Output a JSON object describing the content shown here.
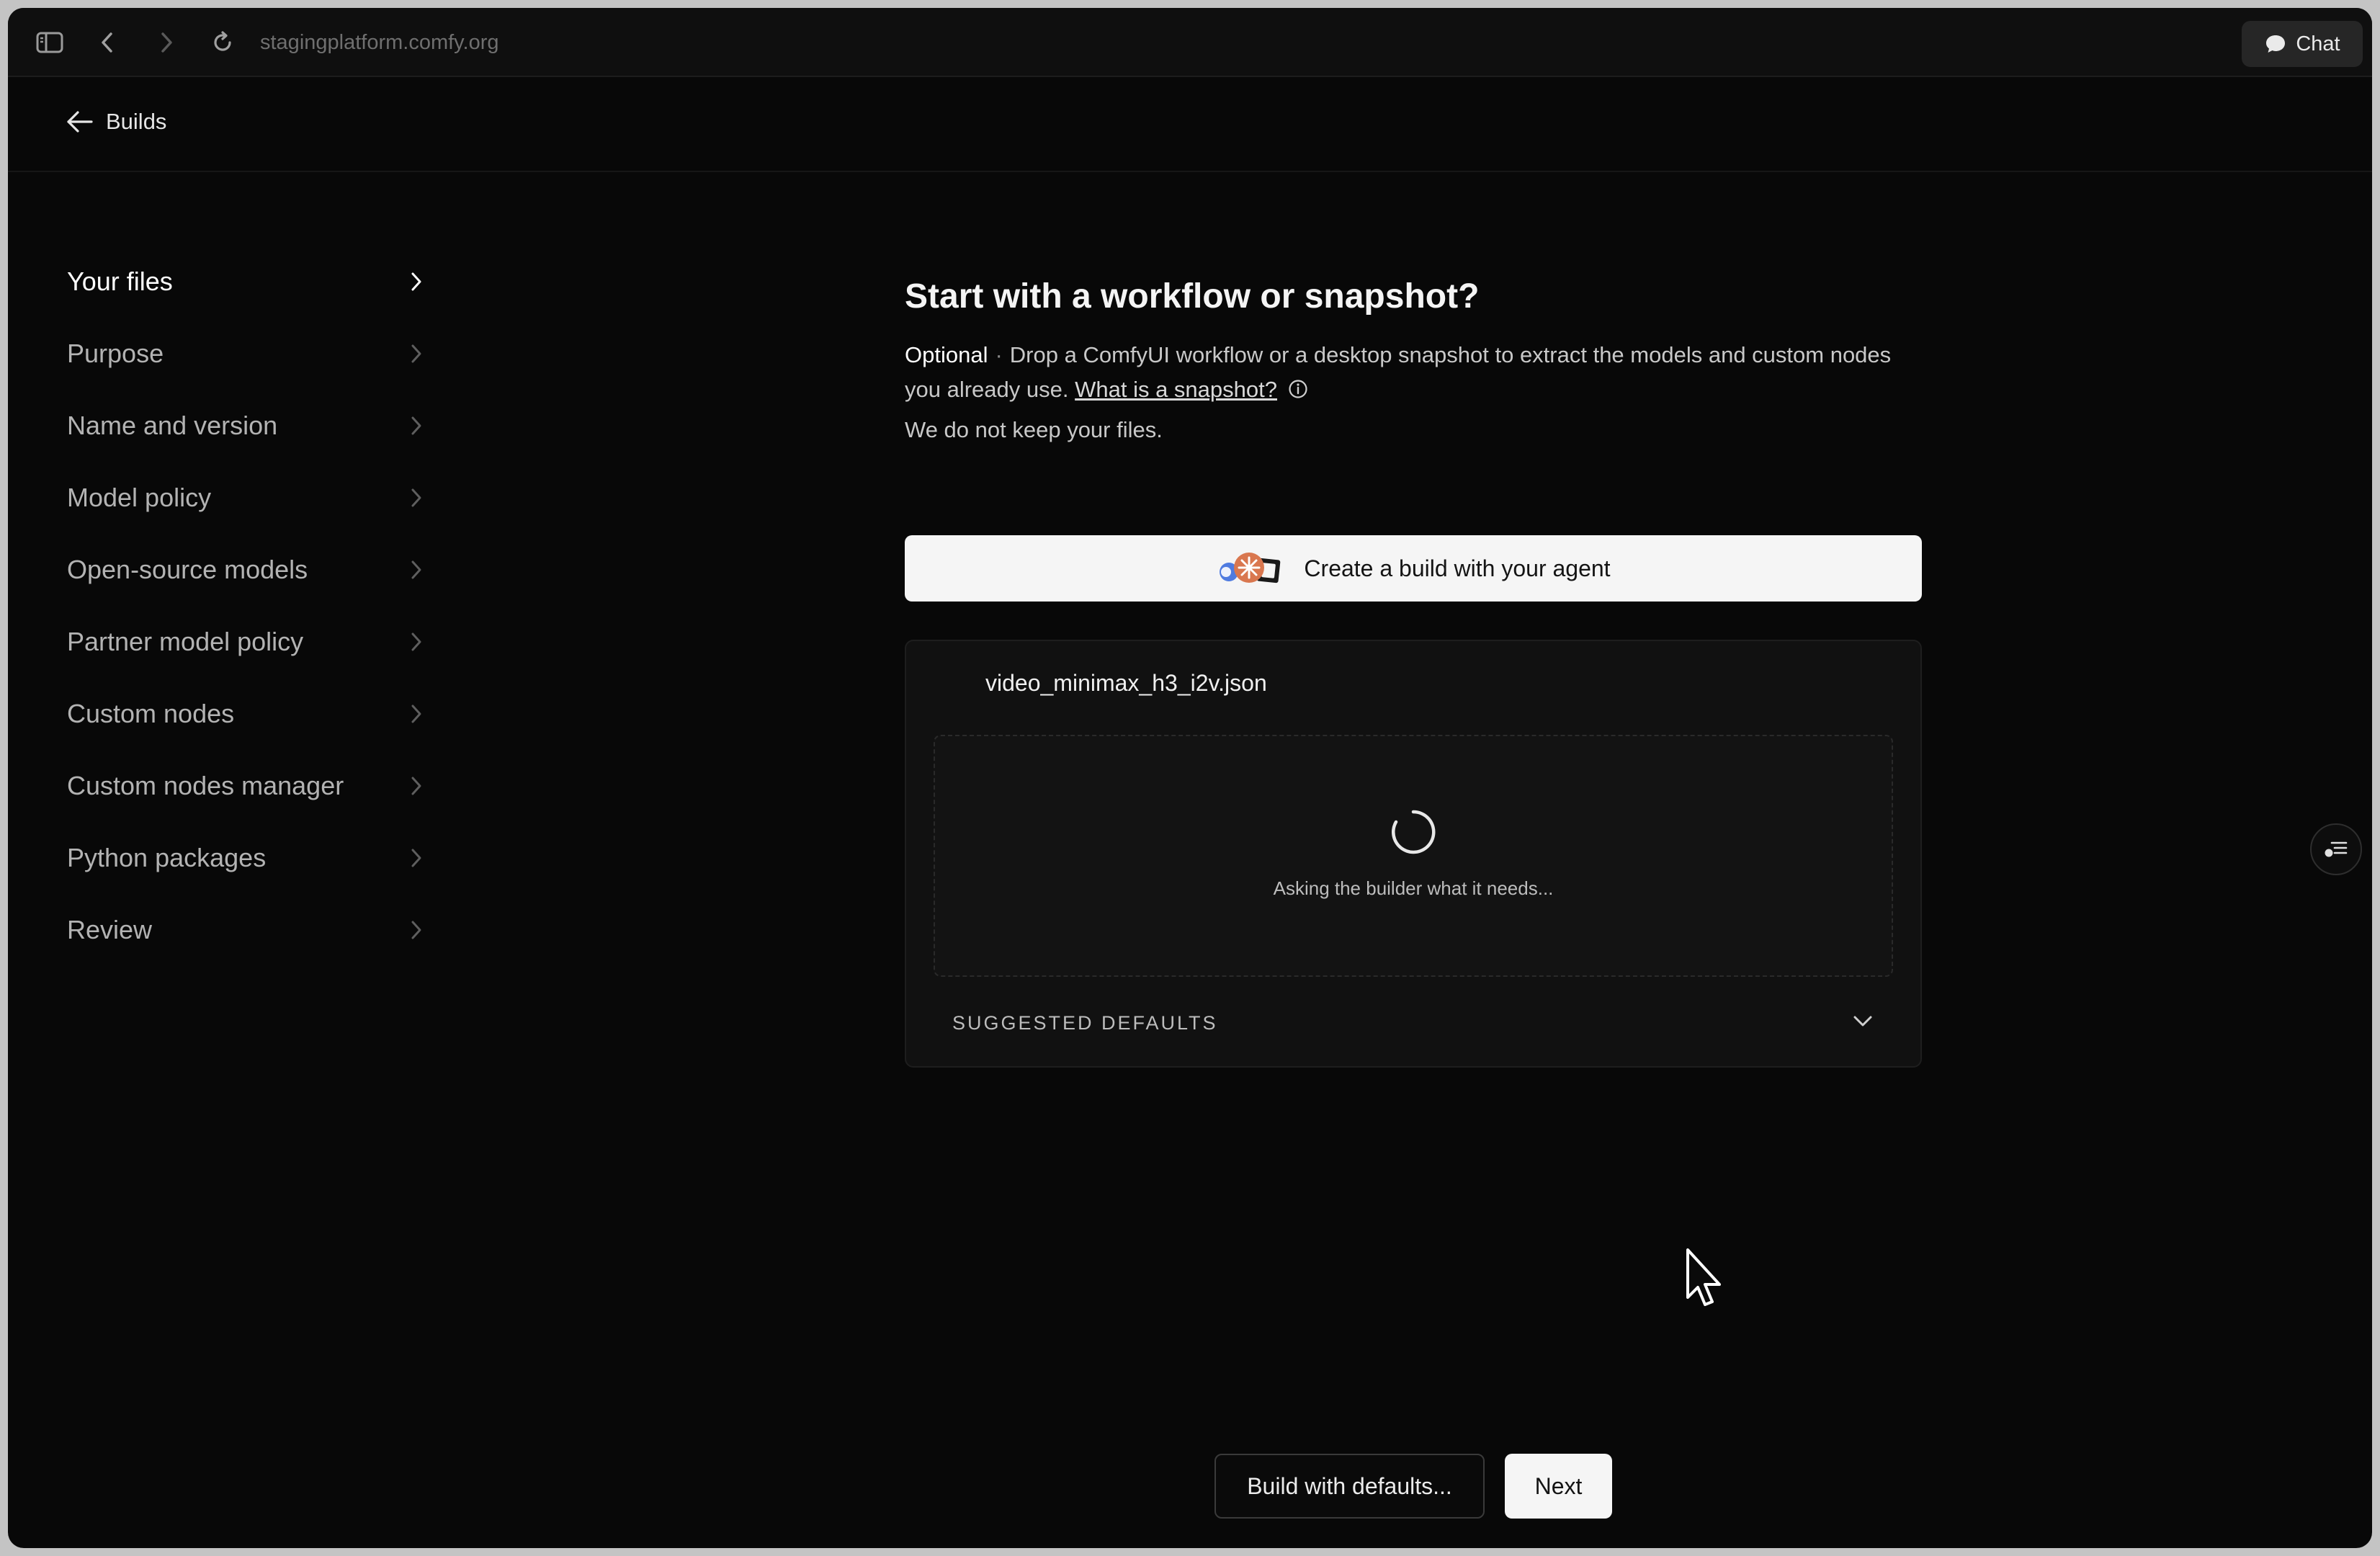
{
  "browser": {
    "url": "stagingplatform.comfy.org",
    "chat_label": "Chat",
    "icons": [
      "sidebar-toggle-icon",
      "back-arrow-icon",
      "forward-arrow-icon",
      "reload-icon",
      "chat-bubble-icon"
    ]
  },
  "header": {
    "back_label": "Builds"
  },
  "steps": [
    {
      "label": "Your files",
      "active": true
    },
    {
      "label": "Purpose",
      "active": false
    },
    {
      "label": "Name and version",
      "active": false
    },
    {
      "label": "Model policy",
      "active": false
    },
    {
      "label": "Open-source models",
      "active": false
    },
    {
      "label": "Partner model policy",
      "active": false
    },
    {
      "label": "Custom nodes",
      "active": false
    },
    {
      "label": "Custom nodes manager",
      "active": false
    },
    {
      "label": "Python packages",
      "active": false
    },
    {
      "label": "Review",
      "active": false
    }
  ],
  "main": {
    "title": "Start with a workflow or snapshot?",
    "optional_label": "Optional",
    "separator": "·",
    "description": "Drop a ComfyUI workflow or a desktop snapshot to extract the models and custom nodes you already use.",
    "snapshot_link": "What is a snapshot?",
    "note": "We do not keep your files.",
    "agent_button_label": "Create a build with your agent",
    "file": {
      "name": "video_minimax_h3_i2v.json",
      "loading_text": "Asking the builder what it needs...",
      "defaults_label": "SUGGESTED DEFAULTS"
    }
  },
  "footer": {
    "build_defaults_label": "Build with defaults...",
    "next_label": "Next"
  },
  "colors": {
    "background": "#080808",
    "primary_button": "#f5f5f5",
    "text": "#f2f2f2",
    "muted_text": "#b3b3b3"
  }
}
